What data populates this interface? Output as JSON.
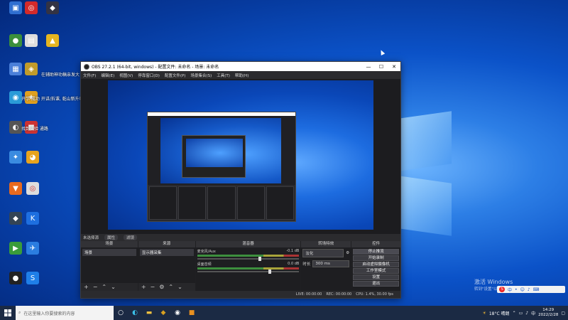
{
  "obs": {
    "title": "OBS 27.2.1 (64-bit, windows) - 配置文件: 未命名 - 场景: 未命名",
    "menu": [
      "文件(F)",
      "编辑(E)",
      "视图(V)",
      "停靠窗口(D)",
      "配置文件(P)",
      "场景集合(S)",
      "工具(T)",
      "帮助(H)"
    ],
    "status_line": {
      "label": "未选择源",
      "props": "属性",
      "filters": "滤镜"
    },
    "docks": {
      "scenes": {
        "title": "场景",
        "item": "场景"
      },
      "sources": {
        "title": "来源",
        "item": "显示器采集"
      },
      "mixer": {
        "title": "混音器",
        "tracks": [
          {
            "name": "麦克风/Aux",
            "db": "-0.1 dB",
            "level": 0.6
          },
          {
            "name": "桌面音频",
            "db": "0.0 dB",
            "level": 0.7
          }
        ]
      },
      "transitions": {
        "title": "转场特效",
        "type": "淡化",
        "duration_label": "时长",
        "duration": "300 ms"
      },
      "controls": {
        "title": "控件",
        "buttons": [
          "停止推流",
          "开始录制",
          "启动虚拟摄像机",
          "工作室模式",
          "设置",
          "退出"
        ]
      }
    },
    "statusbar": {
      "live": "LIVE: 00:00:00",
      "rec": "REC: 00:00:00",
      "cpu": "CPU: 1.4%, 30.00 fps"
    }
  },
  "desktop": {
    "overlays": [
      "在辅助神功稿亲发大",
      "开学 成功 开讲/拆课, 乾山新升唱",
      "找到实验 通路"
    ]
  },
  "watermark": {
    "line1": "激活 Windows",
    "line2": "转到\"设置\"以激活 Windows。"
  },
  "taskbar": {
    "search_placeholder": "在这里输入你要搜索的内容",
    "weather": "18°C 晴朗",
    "time": "14:29",
    "date": "2022/2/28"
  },
  "colors": {
    "obs_bg": "#1f1f22",
    "accent": "#0b52c8"
  }
}
